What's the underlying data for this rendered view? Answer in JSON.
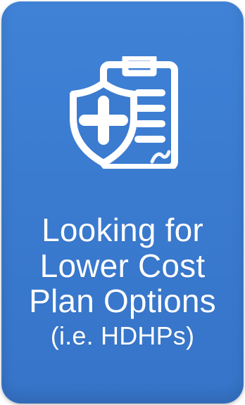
{
  "tile": {
    "icon": "insurance-policy-icon",
    "title_lines": [
      "Looking for",
      "Lower Cost",
      "Plan Options"
    ],
    "subtitle": "(i.e. HDHPs)",
    "background_color": "#3b7bd0",
    "text_color": "#ffffff"
  }
}
